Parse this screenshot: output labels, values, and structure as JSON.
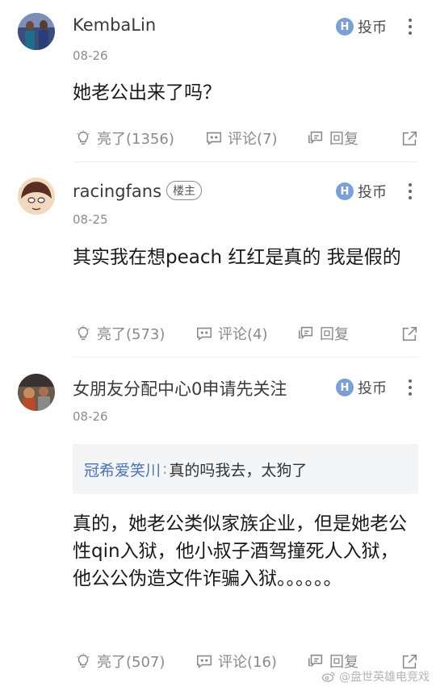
{
  "comments": [
    {
      "username": "KembaLin",
      "badge": "",
      "date": "08-26",
      "coin_label": "投币",
      "content": "她老公出来了吗？",
      "quote": null,
      "actions": {
        "like": "亮了(1356)",
        "comment": "评论(7)",
        "reply": "回复"
      }
    },
    {
      "username": "racingfans",
      "badge": "楼主",
      "date": "08-25",
      "coin_label": "投币",
      "content": "其实我在想peach 红红是真的 我是假的",
      "quote": null,
      "actions": {
        "like": "亮了(573)",
        "comment": "评论(4)",
        "reply": "回复"
      }
    },
    {
      "username": "女朋友分配中心0申请先关注",
      "badge": "",
      "date": "08-26",
      "coin_label": "投币",
      "content": "真的，她老公类似家族企业，但是她老公性qin入狱，他小叔子酒驾撞死人入狱，他公公伪造文件诈骗入狱。。。。。。",
      "quote": {
        "user": "冠希爱笑川",
        "sep": ":",
        "text": "真的吗我去，太狗了"
      },
      "actions": {
        "like": "亮了(507)",
        "comment": "评论(16)",
        "reply": "回复"
      }
    }
  ],
  "coin_icon_letter": "H",
  "watermark": "@盘世英雄电竞戏",
  "colors": {
    "accent_blue": "#4a72b5",
    "coin_icon": "#7c9fd6",
    "muted": "#8a8a8a"
  }
}
